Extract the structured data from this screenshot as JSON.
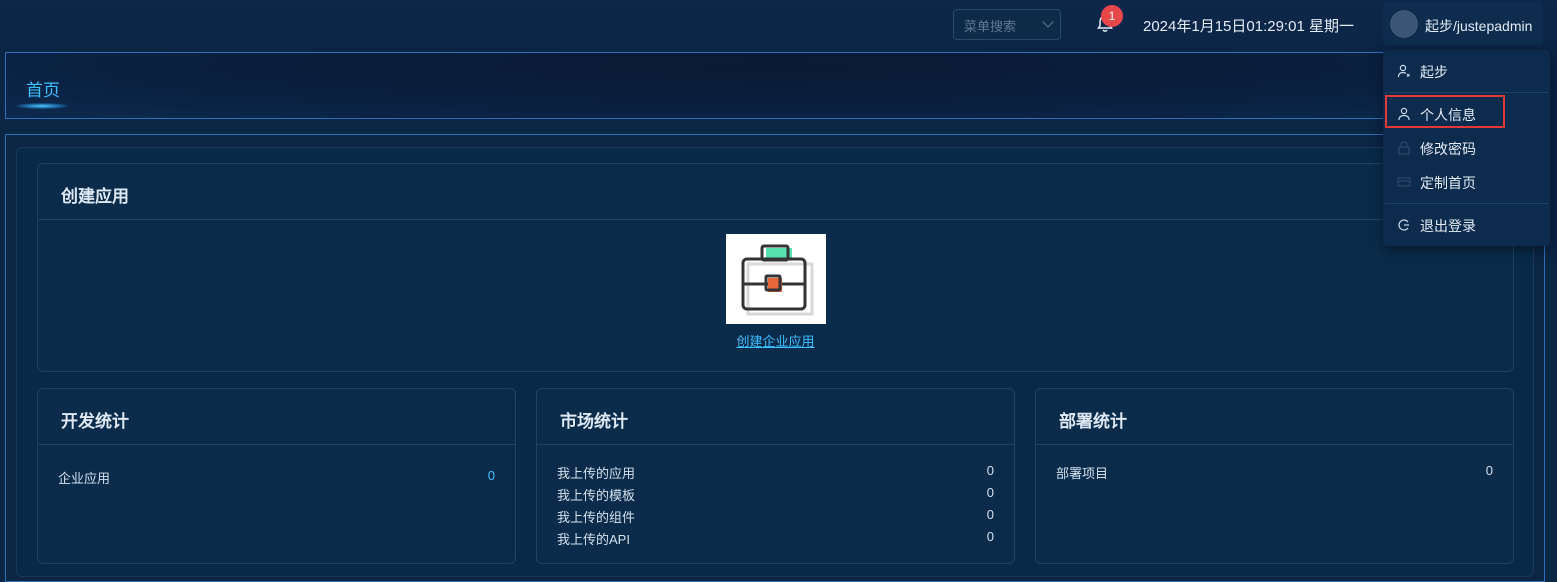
{
  "header": {
    "menu_search_placeholder": "菜单搜索",
    "notification_count": "1",
    "datetime": "2024年1月15日01:29:01 星期一",
    "user": "起步/justepadmin"
  },
  "tabs": [
    {
      "label": "首页"
    }
  ],
  "create_app": {
    "title": "创建应用",
    "link_label": "创建企业应用"
  },
  "dev_stats": {
    "title": "开发统计",
    "rows": [
      {
        "label": "企业应用",
        "value": "0"
      }
    ]
  },
  "market_stats": {
    "title": "市场统计",
    "rows": [
      {
        "label": "我上传的应用",
        "value": "0"
      },
      {
        "label": "我上传的模板",
        "value": "0"
      },
      {
        "label": "我上传的组件",
        "value": "0"
      },
      {
        "label": "我上传的API",
        "value": "0"
      }
    ]
  },
  "deploy_stats": {
    "title": "部署统计",
    "rows": [
      {
        "label": "部署项目",
        "value": "0"
      }
    ]
  },
  "user_menu": {
    "items": [
      {
        "label": "起步",
        "icon": "user-start-icon"
      },
      {
        "label": "个人信息",
        "icon": "user-icon"
      },
      {
        "label": "修改密码",
        "icon": "lock-icon"
      },
      {
        "label": "定制首页",
        "icon": "layout-icon"
      },
      {
        "label": "退出登录",
        "icon": "logout-icon"
      }
    ]
  },
  "colors": {
    "accent": "#3fc0ff",
    "background": "#0b2545",
    "badge": "#e8474a",
    "highlight_box": "#e53935"
  }
}
